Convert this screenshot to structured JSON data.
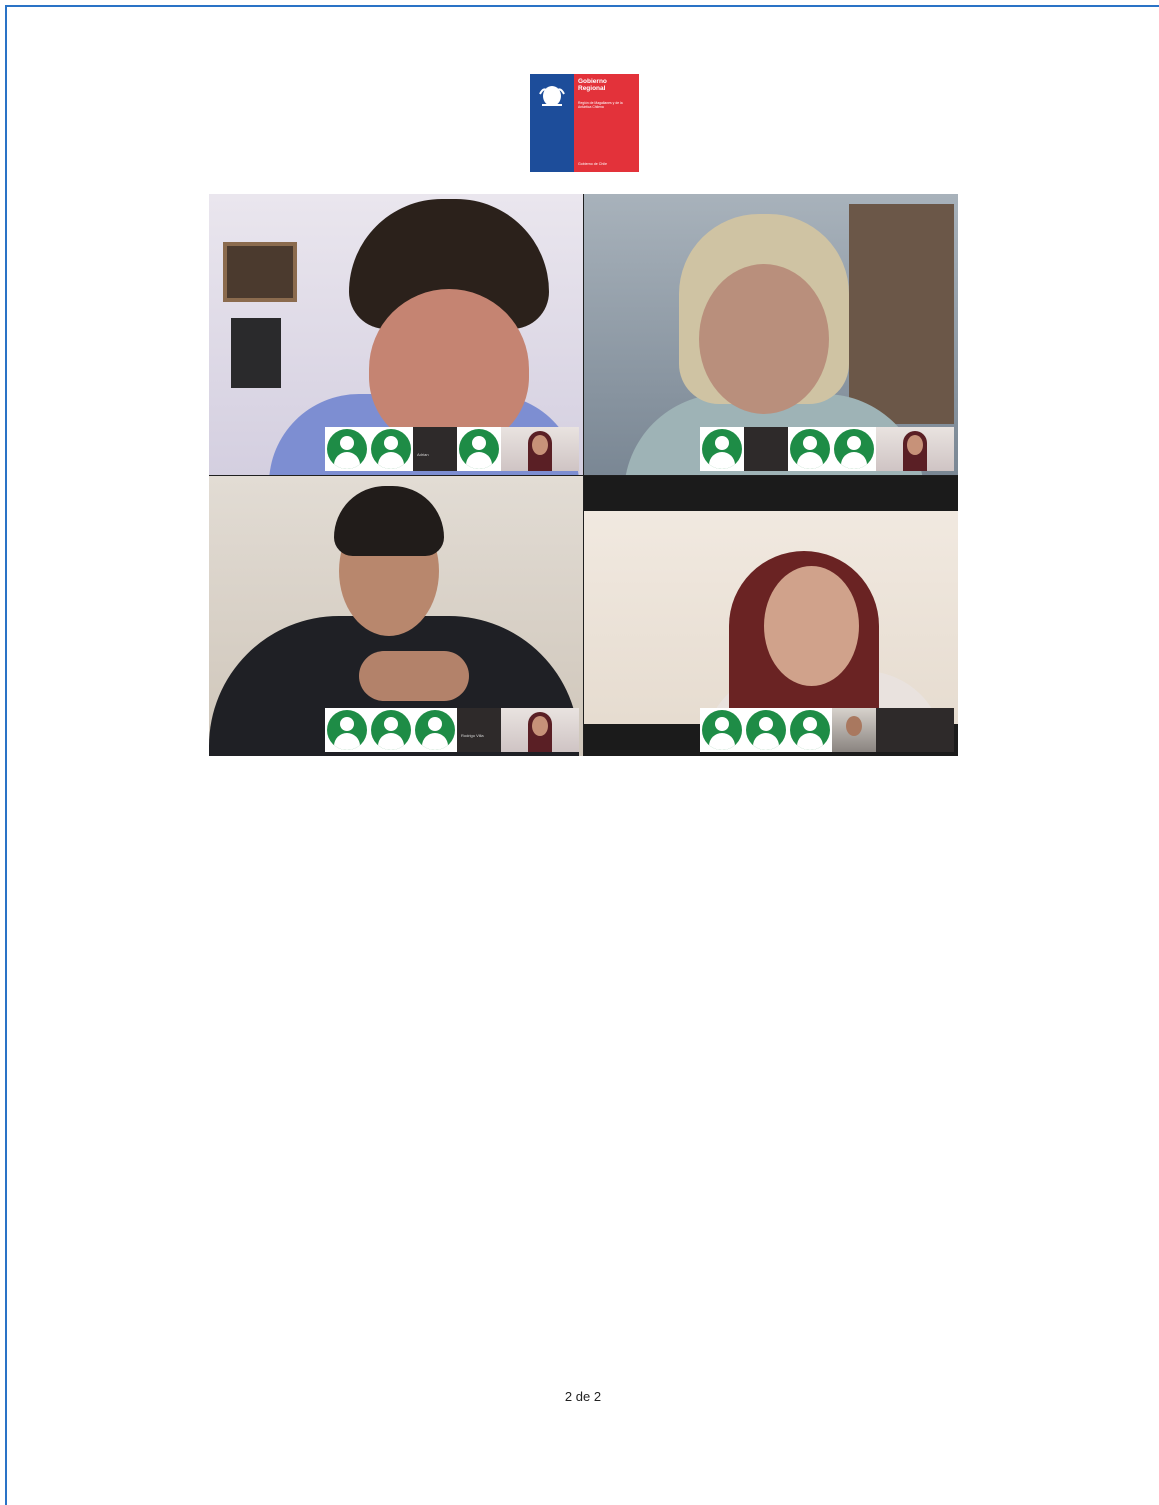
{
  "logo": {
    "line1": "Gobierno",
    "line2": "Regional",
    "subtitle": "Región de Magallanes y de la Antártica Chilena",
    "footer": "Gobierno de Chile",
    "colors": {
      "blue": "#1d4d9a",
      "red": "#e3323a"
    }
  },
  "collage": {
    "tiles": [
      {
        "thumb_names": [
          "",
          "",
          "Adrian",
          "",
          ""
        ]
      },
      {
        "thumb_names": [
          "",
          "",
          "",
          "",
          ""
        ]
      },
      {
        "thumb_names": [
          "",
          "",
          "",
          "Rodrigo Villa",
          ""
        ]
      },
      {
        "thumb_names": [
          "",
          "",
          "",
          "",
          ""
        ]
      }
    ],
    "avatar_color": "#1e8c46"
  },
  "footer": {
    "page_number": "2 de 2"
  }
}
